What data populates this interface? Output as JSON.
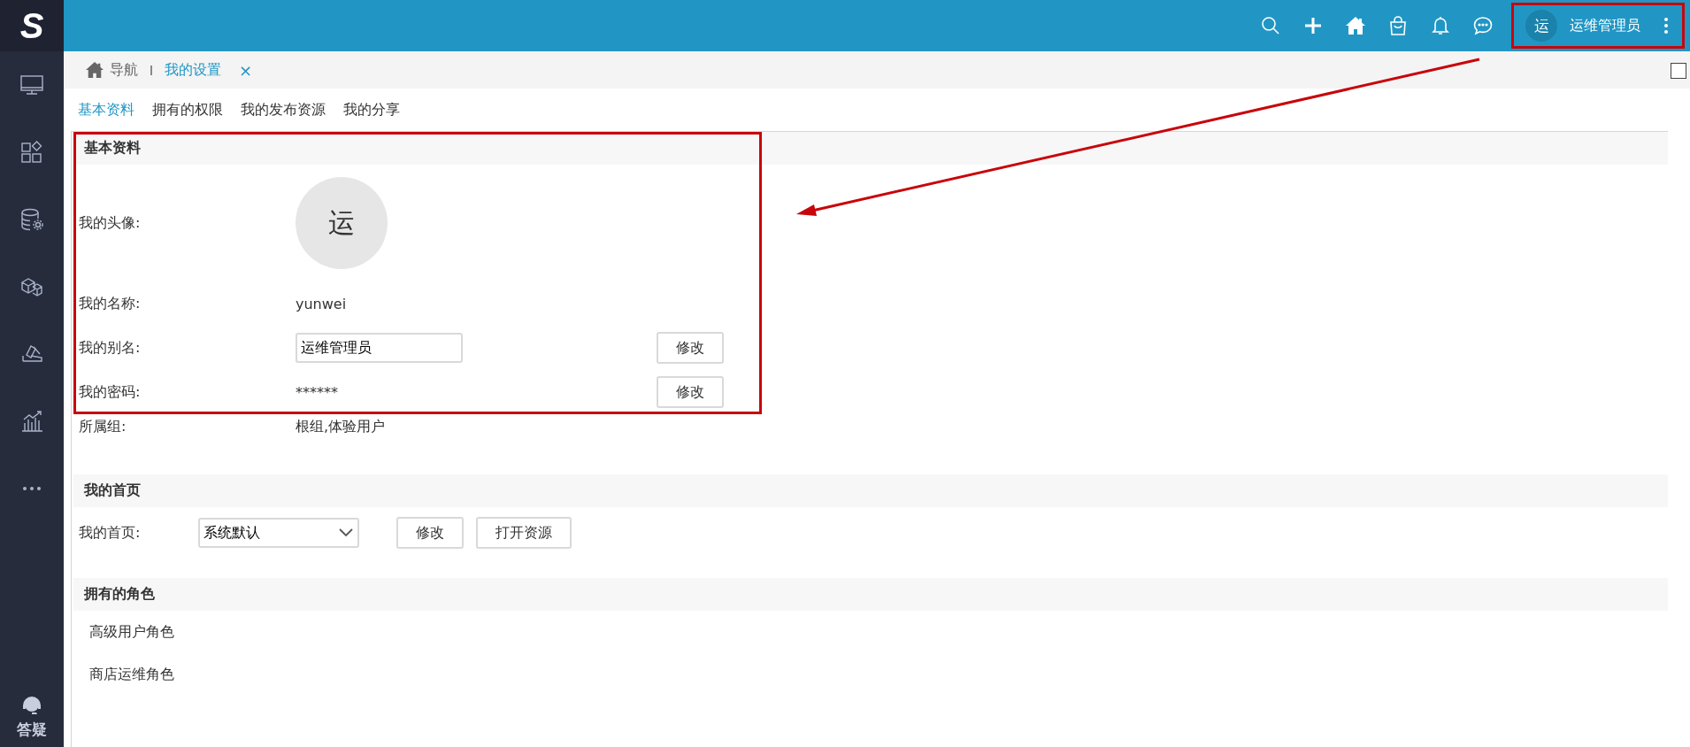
{
  "sidebar": {
    "logo": "S",
    "items": [
      {
        "kind": "monitor"
      },
      {
        "kind": "widgets"
      },
      {
        "kind": "database"
      },
      {
        "kind": "cubes"
      },
      {
        "kind": "hammer"
      },
      {
        "kind": "chart"
      },
      {
        "kind": "more"
      }
    ],
    "help": {
      "label": "答疑"
    }
  },
  "topbar": {
    "icons": [
      {
        "kind": "search"
      },
      {
        "kind": "plus"
      },
      {
        "kind": "home"
      },
      {
        "kind": "bag"
      },
      {
        "kind": "bell"
      },
      {
        "kind": "chat"
      }
    ],
    "user": {
      "avatar": "运",
      "name": "运维管理员",
      "highlighted": true
    }
  },
  "breadcrumb": {
    "items": [
      {
        "label": "导航",
        "selected": false
      },
      {
        "label": "我的设置",
        "selected": true
      }
    ],
    "close": "×"
  },
  "tabs": [
    {
      "label": "基本资料",
      "selected": true
    },
    {
      "label": "拥有的权限",
      "selected": false
    },
    {
      "label": "我的发布资源",
      "selected": false
    },
    {
      "label": "我的分享",
      "selected": false
    }
  ],
  "sections": [
    {
      "title": "基本资料",
      "highlighted": true,
      "rows": [
        {
          "kind": "avatar",
          "label": "我的头像:",
          "value": "运"
        },
        {
          "kind": "text",
          "label": "我的名称:",
          "value": "yunwei"
        },
        {
          "kind": "input",
          "label": "我的别名:",
          "value": "运维管理员",
          "button": "修改"
        },
        {
          "kind": "text",
          "label": "我的密码:",
          "value": "******",
          "button": "修改"
        }
      ],
      "extra_rows": [
        {
          "kind": "group",
          "label": "所属组:",
          "value": "根组,体验用户"
        }
      ]
    },
    {
      "title": "我的首页",
      "highlighted": false,
      "rows": [
        {
          "kind": "select",
          "label": "我的首页:",
          "value": "系统默认",
          "buttons": [
            "修改",
            "打开资源"
          ]
        }
      ]
    },
    {
      "title": "拥有的角色",
      "highlighted": false,
      "rows": [
        {
          "kind": "role",
          "value": "高级用户角色"
        },
        {
          "kind": "role",
          "value": "商店运维角色"
        }
      ]
    }
  ]
}
